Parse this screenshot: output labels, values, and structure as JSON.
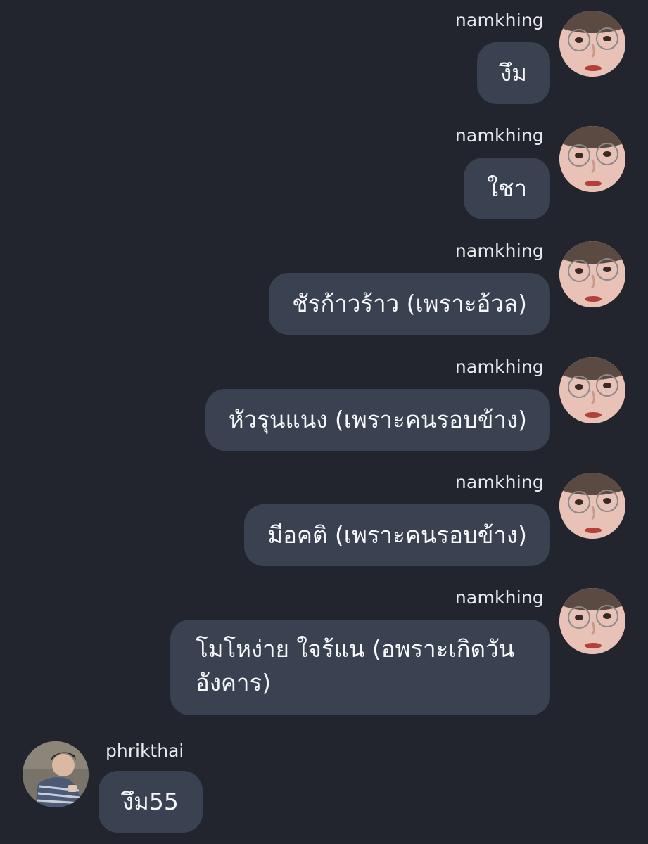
{
  "messages": [
    {
      "sender": "namkhing",
      "text": "งึม",
      "side": "right"
    },
    {
      "sender": "namkhing",
      "text": "ใชา",
      "side": "right"
    },
    {
      "sender": "namkhing",
      "text": "ชัรก้าวร้าว (เพราะอ้วล)",
      "side": "right"
    },
    {
      "sender": "namkhing",
      "text": "หัวรุนแนง (เพราะคนรอบข้าง)",
      "side": "right"
    },
    {
      "sender": "namkhing",
      "text": "มีอคติ (เพราะคนรอบข้าง)",
      "side": "right"
    },
    {
      "sender": "namkhing",
      "text": "โมโหง่าย ใจร้แน (อพราะเกิดวันอังคาร)",
      "side": "right"
    },
    {
      "sender": "phrikthai",
      "text": "งึม55",
      "side": "left"
    }
  ],
  "colors": {
    "background": "#22252d",
    "bubble": "#3a4252",
    "text": "#f7f8fa"
  }
}
